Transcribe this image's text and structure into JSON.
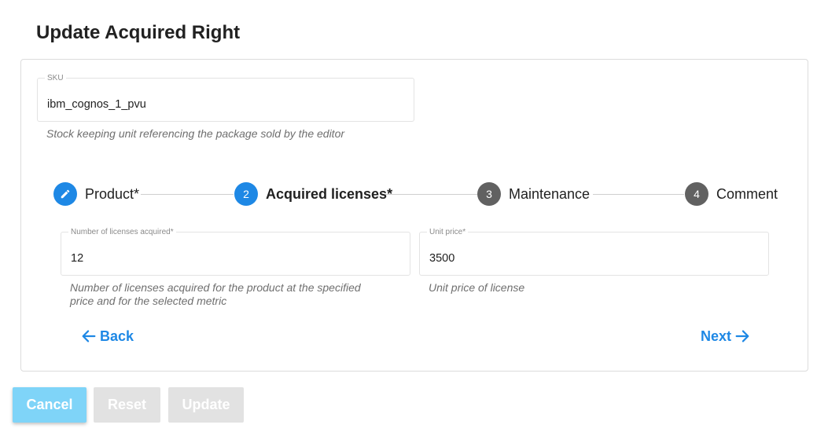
{
  "page": {
    "title": "Update Acquired Right"
  },
  "sku": {
    "label": "SKU",
    "value": "ibm_cognos_1_pvu",
    "hint": "Stock keeping unit referencing the package sold by the editor"
  },
  "stepper": {
    "steps": [
      {
        "number": "",
        "label": "Product*",
        "state": "edited",
        "icon": "pencil-icon"
      },
      {
        "number": "2",
        "label": "Acquired licenses*",
        "state": "active"
      },
      {
        "number": "3",
        "label": "Maintenance",
        "state": "pending"
      },
      {
        "number": "4",
        "label": "Comment",
        "state": "pending"
      }
    ]
  },
  "licenses": {
    "label": "Number of licenses acquired*",
    "value": "12",
    "hint_line1": "Number of licenses acquired for the product at the specified",
    "hint_line2": "price and for the selected metric"
  },
  "unit_price": {
    "label": "Unit price*",
    "value": "3500",
    "hint": "Unit price of license"
  },
  "navigation": {
    "back_label": "Back",
    "next_label": "Next"
  },
  "actions": {
    "cancel_label": "Cancel",
    "reset_label": "Reset",
    "update_label": "Update"
  },
  "colors": {
    "accent": "#1e88e5",
    "cancel_button": "#7fd4f8",
    "disabled_button": "#e2e2e2",
    "step_inactive": "#616161"
  }
}
